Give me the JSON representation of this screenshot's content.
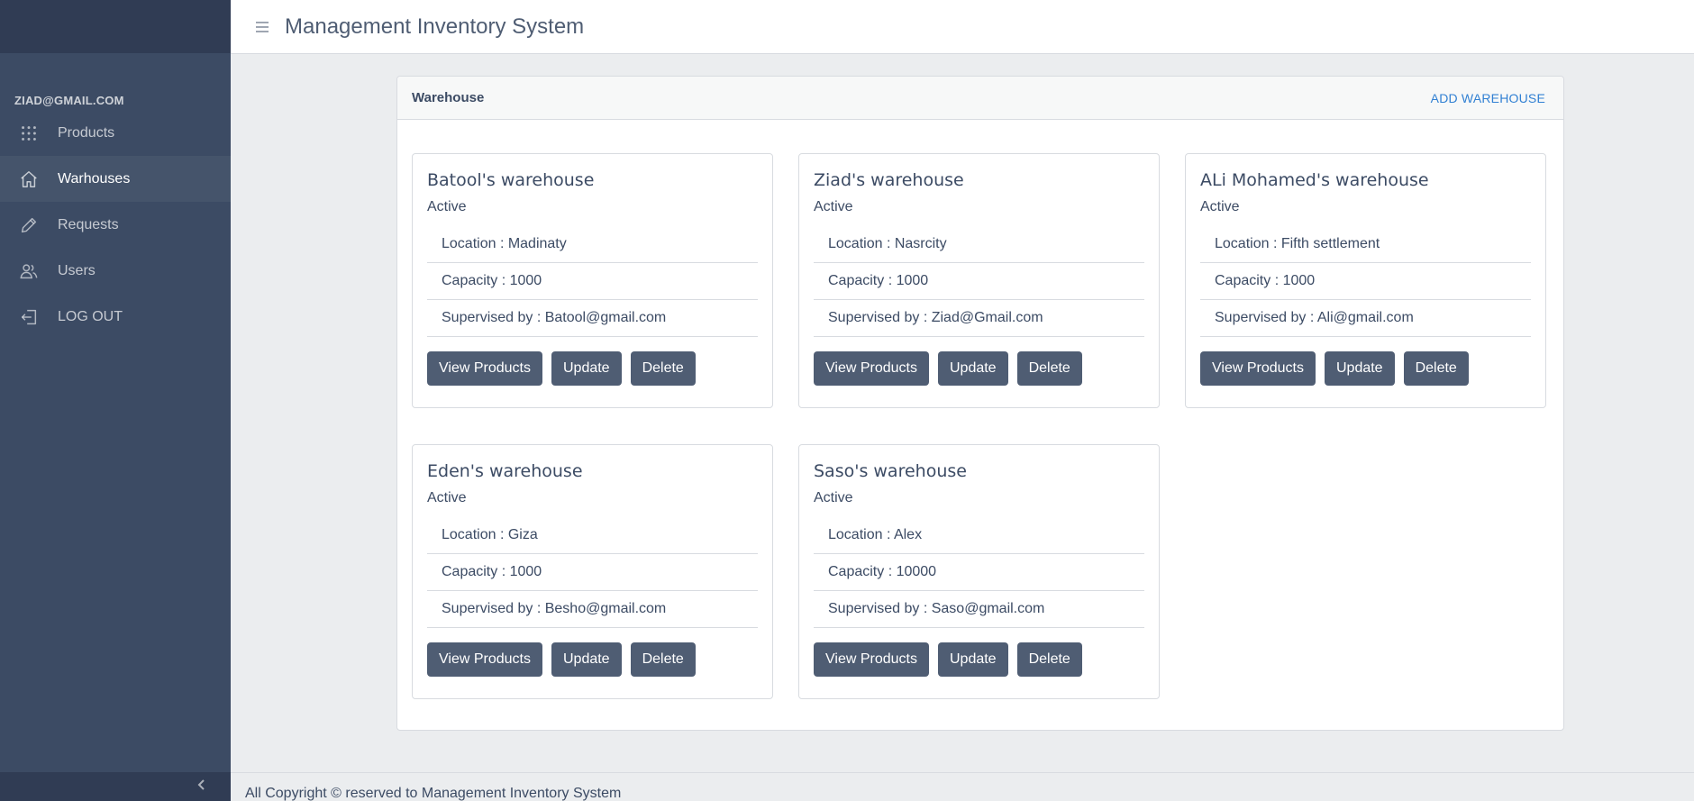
{
  "app": {
    "title": "Management Inventory System"
  },
  "sidebar": {
    "user_email": "ZIAD@GMAIL.COM",
    "items": [
      {
        "label": "Products",
        "icon": "grid-icon",
        "active": false
      },
      {
        "label": "Warhouses",
        "icon": "home-icon",
        "active": true
      },
      {
        "label": "Requests",
        "icon": "pencil-icon",
        "active": false
      },
      {
        "label": "Users",
        "icon": "users-icon",
        "active": false
      },
      {
        "label": "LOG OUT",
        "icon": "logout-icon",
        "active": false
      }
    ],
    "toggler_icon": "chevron-left-icon"
  },
  "main": {
    "card_title": "Warehouse",
    "add_label": "ADD WAREHOUSE",
    "warehouses": [
      {
        "name": "Batool's warehouse",
        "status": "Active",
        "location": "Location : Madinaty",
        "capacity": "Capacity : 1000",
        "supervisor": "Supervised by : Batool@gmail.com"
      },
      {
        "name": "Ziad's warehouse",
        "status": "Active",
        "location": "Location : Nasrcity",
        "capacity": "Capacity : 1000",
        "supervisor": "Supervised by : Ziad@Gmail.com"
      },
      {
        "name": "ALi Mohamed's warehouse",
        "status": "Active",
        "location": "Location : Fifth settlement",
        "capacity": "Capacity : 1000",
        "supervisor": "Supervised by : Ali@gmail.com"
      },
      {
        "name": "Eden's warehouse",
        "status": "Active",
        "location": "Location : Giza",
        "capacity": "Capacity : 1000",
        "supervisor": "Supervised by : Besho@gmail.com"
      },
      {
        "name": "Saso's warehouse",
        "status": "Active",
        "location": "Location : Alex",
        "capacity": "Capacity : 10000",
        "supervisor": "Supervised by : Saso@gmail.com"
      }
    ],
    "buttons": {
      "view_label": "View Products",
      "update_label": "Update",
      "delete_label": "Delete"
    }
  },
  "footer": {
    "text": "All Copyright © reserved to Management Inventory System"
  },
  "colors": {
    "sidebar_bg": "#3c4b64",
    "button_bg": "#4f5d73",
    "link": "#3180d3",
    "page_bg": "#ebedef"
  }
}
